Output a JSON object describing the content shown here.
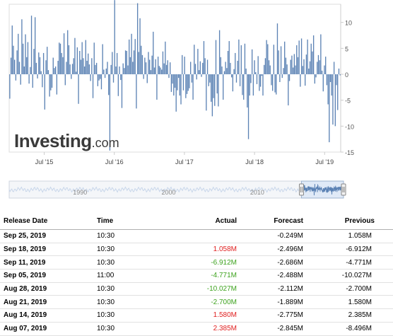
{
  "chart_data": {
    "type": "bar",
    "title": "",
    "xlabel": "",
    "ylabel": "",
    "ylim": [
      -15,
      13.5
    ],
    "yticks": [
      10,
      5,
      0,
      -5,
      -10,
      -15
    ],
    "xticks": [
      "Jul '15",
      "Jul '16",
      "Jul '17",
      "Jul '18",
      "Jul '19"
    ],
    "x_range": [
      "2015-01",
      "2019-09"
    ],
    "bar_color": "#5b82b4",
    "values": [
      -4.7,
      3.2,
      9.4,
      5.5,
      2.8,
      -1.2,
      4.6,
      7.8,
      2.4,
      -2.0,
      10.6,
      5.9,
      1.5,
      7.7,
      3.3,
      6.2,
      -1.8,
      1.4,
      11.3,
      -2.6,
      4.9,
      11.0,
      2.2,
      -0.8,
      4.2,
      3.3,
      0.6,
      -2.5,
      4.1,
      -6.8,
      2.7,
      5.3,
      0.8,
      -4.3,
      -3.1,
      -2.6,
      3.2,
      1.2,
      1.5,
      -3.9,
      2.6,
      6.1,
      5.9,
      4.1,
      3.3,
      7.9,
      -2.1,
      2.4,
      8.5,
      5.6,
      1.9,
      -0.9,
      2.0,
      3.1,
      7.0,
      0.5,
      5.2,
      -5.7,
      4.5,
      2.8,
      6.2,
      3.1,
      1.5,
      6.6,
      2.6,
      4.0,
      1.9,
      -1.3,
      3.1,
      -4.6,
      6.1,
      1.8,
      2.2,
      -2.3,
      -1.2,
      -0.9,
      -2.9,
      5.8,
      0.9,
      -0.7,
      1.1,
      2.4,
      -4.0,
      -14.7,
      1.8,
      4.3,
      -1.6,
      14.3,
      1.5,
      4.1,
      -4.2,
      1.5,
      -1.1,
      -6.5,
      2.1,
      1.2,
      4.6,
      4.5,
      1.7,
      6.7,
      3.3,
      7.8,
      2.4,
      4.6,
      6.8,
      -6.6,
      13.7,
      4.3,
      10.8,
      5.5,
      3.7,
      -0.9,
      3.2,
      2.3,
      -1.7,
      4.3,
      2.8,
      0.8,
      3.6,
      8.2,
      1.3,
      2.9,
      -4.9,
      3.4,
      1.6,
      1.3,
      0.9,
      4.4,
      2.1,
      6.3,
      1.8,
      2.7,
      -0.7,
      2.3,
      -3.4,
      -1.8,
      -4.1,
      -2.6,
      -7.2,
      -3.1,
      -0.7,
      -4.1,
      -5.8,
      3.7,
      -3.1,
      3.4,
      -4.6,
      -3.8,
      -3.2,
      -2.7,
      2.4,
      -1.6,
      -4.9,
      5.7,
      2.0,
      -1.0,
      4.9,
      0.8,
      2.5,
      -0.5,
      2.2,
      6.4,
      3.1,
      -7.0,
      2.8,
      -2.3,
      -1.6,
      -5.3,
      -8.1,
      -4.6,
      -6.1,
      6.6,
      -3.7,
      -6.2,
      8.5,
      3.3,
      1.5,
      -4.9,
      0.6,
      2.4,
      1.2,
      4.5,
      6.4,
      2.2,
      -0.6,
      -3.3,
      1.0,
      4.1,
      -1.6,
      2.6,
      6.7,
      -2.3,
      5.6,
      -4.0,
      -4.9,
      5.9,
      1.1,
      -6.4,
      -12.5,
      -4.1,
      -1.7,
      4.8,
      -4.1,
      2.7,
      0.4,
      -1.9,
      3.5,
      -3.2,
      -2.4,
      -0.3,
      -4.1,
      1.8,
      3.1,
      6.6,
      5.8,
      2.7,
      1.7,
      -2.1,
      -3.2,
      5.7,
      -3.5,
      -3.9,
      9.8,
      4.6,
      -1.5,
      5.4,
      -0.7,
      1.2,
      6.3,
      3.2,
      1.9,
      -6.0,
      -1.3,
      2.8,
      3.6,
      1.3,
      3.9,
      1.7,
      5.6,
      3.3,
      6.5,
      -2.4,
      6.9,
      1.6,
      2.9,
      -2.2,
      3.8,
      6.7,
      1.1,
      2.5,
      5.9,
      4.4,
      7.5,
      -1.8,
      -0.6,
      2.4,
      3.7,
      2.7,
      7.7,
      0.7,
      -3.3,
      1.7,
      3.4,
      -2.1,
      -5.8,
      -13.1,
      -1.5,
      -4.1,
      -9.7,
      2.4,
      -10.0,
      -2.1,
      -6.9,
      1.1,
      -0.2
    ],
    "navigator": {
      "labels": [
        "1990",
        "2000",
        "2010"
      ],
      "range": [
        1982,
        2019.75
      ],
      "selection": [
        2015,
        2019.75
      ]
    }
  },
  "logo": {
    "brand": "Investing",
    "tld": ".com"
  },
  "table": {
    "headers": [
      "Release Date",
      "Time",
      "Actual",
      "Forecast",
      "Previous"
    ],
    "rows": [
      {
        "date": "Sep 25, 2019",
        "time": "10:30",
        "actual": "",
        "actual_trend": "",
        "forecast": "-0.249M",
        "previous": "1.058M"
      },
      {
        "date": "Sep 18, 2019",
        "time": "10:30",
        "actual": "1.058M",
        "actual_trend": "pos",
        "forecast": "-2.496M",
        "previous": "-6.912M"
      },
      {
        "date": "Sep 11, 2019",
        "time": "10:30",
        "actual": "-6.912M",
        "actual_trend": "neg",
        "forecast": "-2.686M",
        "previous": "-4.771M"
      },
      {
        "date": "Sep 05, 2019",
        "time": "11:00",
        "actual": "-4.771M",
        "actual_trend": "neg",
        "forecast": "-2.488M",
        "previous": "-10.027M"
      },
      {
        "date": "Aug 28, 2019",
        "time": "10:30",
        "actual": "-10.027M",
        "actual_trend": "neg",
        "forecast": "-2.112M",
        "previous": "-2.700M"
      },
      {
        "date": "Aug 21, 2019",
        "time": "10:30",
        "actual": "-2.700M",
        "actual_trend": "neg",
        "forecast": "-1.889M",
        "previous": "1.580M"
      },
      {
        "date": "Aug 14, 2019",
        "time": "10:30",
        "actual": "1.580M",
        "actual_trend": "pos",
        "forecast": "-2.775M",
        "previous": "2.385M"
      },
      {
        "date": "Aug 07, 2019",
        "time": "10:30",
        "actual": "2.385M",
        "actual_trend": "pos",
        "forecast": "-2.845M",
        "previous": "-8.496M"
      }
    ]
  },
  "colors": {
    "positive": "#e02020",
    "negative": "#3ea31f",
    "bar": "#5b82b4",
    "navigator_line": "#5b82b4"
  }
}
